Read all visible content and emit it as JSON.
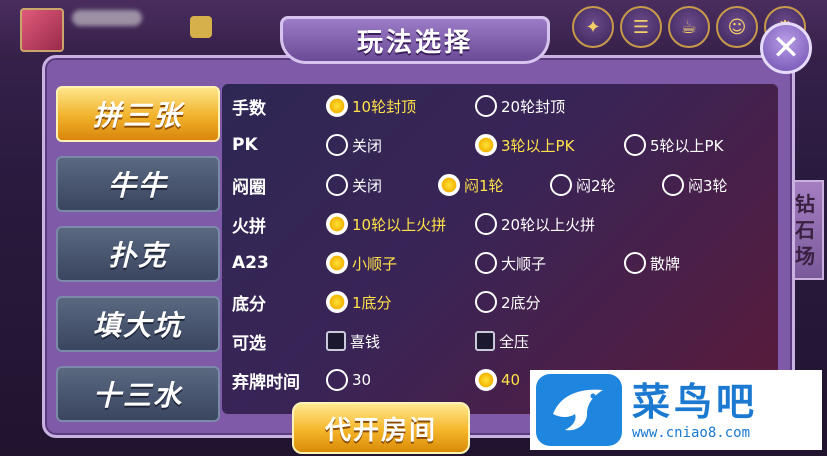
{
  "background": {
    "top_icons": [
      "gift-icon",
      "menu-icon",
      "cup-icon",
      "service-icon",
      "settings-icon"
    ],
    "side_tab_label": [
      "钻",
      "石",
      "场"
    ]
  },
  "dialog": {
    "title": "玩法选择",
    "close_glyph": "✕",
    "tabs": [
      {
        "label": "拼三张",
        "active": true
      },
      {
        "label": "牛牛",
        "active": false
      },
      {
        "label": "扑克",
        "active": false
      },
      {
        "label": "填大坑",
        "active": false
      },
      {
        "label": "十三水",
        "active": false
      }
    ],
    "rows": [
      {
        "label": "手数",
        "options": [
          {
            "text": "10轮封顶",
            "selected": true
          },
          {
            "text": "20轮封顶",
            "selected": false
          }
        ]
      },
      {
        "label": "PK",
        "options": [
          {
            "text": "关闭",
            "selected": false
          },
          {
            "text": "3轮以上PK",
            "selected": true
          },
          {
            "text": "5轮以上PK",
            "selected": false
          }
        ]
      },
      {
        "label": "闷圈",
        "options": [
          {
            "text": "关闭",
            "selected": false
          },
          {
            "text": "闷1轮",
            "selected": true
          },
          {
            "text": "闷2轮",
            "selected": false
          },
          {
            "text": "闷3轮",
            "selected": false
          }
        ]
      },
      {
        "label": "火拼",
        "options": [
          {
            "text": "10轮以上火拼",
            "selected": true
          },
          {
            "text": "20轮以上火拼",
            "selected": false
          }
        ]
      },
      {
        "label": "A23",
        "options": [
          {
            "text": "小顺子",
            "selected": true
          },
          {
            "text": "大顺子",
            "selected": false
          },
          {
            "text": "散牌",
            "selected": false
          }
        ]
      },
      {
        "label": "底分",
        "options": [
          {
            "text": "1底分",
            "selected": true
          },
          {
            "text": "2底分",
            "selected": false
          }
        ]
      },
      {
        "label": "可选",
        "checkboxes": [
          {
            "text": "喜钱",
            "checked": false
          },
          {
            "text": "全压",
            "checked": false
          }
        ]
      },
      {
        "label": "弃牌时间",
        "options": [
          {
            "text": "30",
            "selected": false
          },
          {
            "text": "40",
            "selected": true
          }
        ]
      }
    ],
    "open_room_label": "代开房间"
  },
  "watermark": {
    "cn": "菜鸟吧",
    "url": "www.cniao8.com"
  }
}
